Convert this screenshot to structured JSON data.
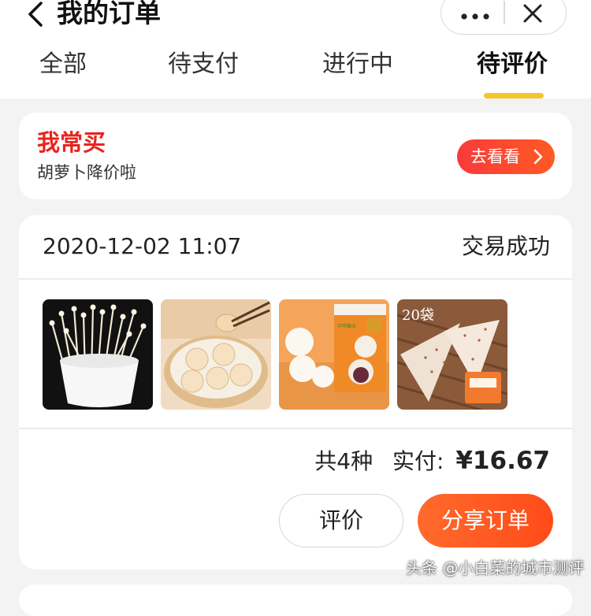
{
  "header": {
    "title": "我的订单",
    "back_icon": "chevron-left-icon",
    "more_icon": "more-dots-icon",
    "close_icon": "close-icon"
  },
  "tabs": [
    {
      "label": "全部",
      "active": false
    },
    {
      "label": "待支付",
      "active": false
    },
    {
      "label": "进行中",
      "active": false
    },
    {
      "label": "待评价",
      "active": true
    }
  ],
  "promo": {
    "title": "我常买",
    "subtitle": "胡萝卜降价啦",
    "button": "去看看"
  },
  "order": {
    "datetime": "2020-12-02 11:07",
    "status": "交易成功",
    "items": [
      {
        "name": "enoki-mushroom-image",
        "label": ""
      },
      {
        "name": "soup-dumpling-image",
        "label": ""
      },
      {
        "name": "steamed-bun-package-image",
        "label": "中华面点"
      },
      {
        "name": "flatbread-image",
        "label": "20袋"
      }
    ],
    "count_text": "共4种",
    "paid_label": "实付:",
    "paid_amount": "¥16.67",
    "review_button": "评价",
    "share_button": "分享订单"
  },
  "watermark": "头条 @小白菜的城市测评",
  "colors": {
    "accent_yellow": "#f6c42b",
    "promo_red": "#e8231e",
    "button_orange": "#ff5a24",
    "background": "#f3f3f3"
  }
}
